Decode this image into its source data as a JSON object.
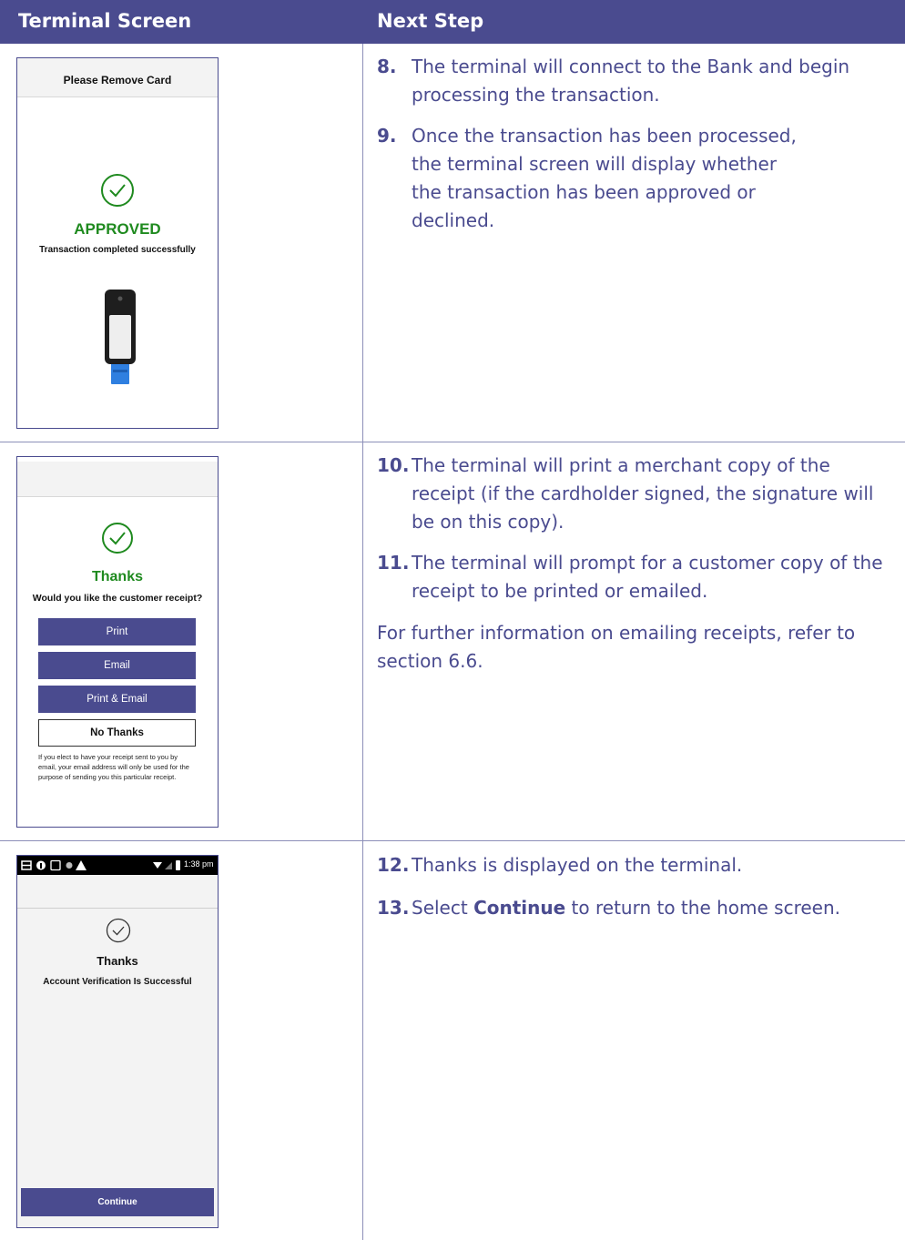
{
  "header": {
    "col1": "Terminal Screen",
    "col2": "Next Step"
  },
  "colors": {
    "brand": "#4a4b8f",
    "approved": "#1f8a1f"
  },
  "rows": [
    {
      "screen": {
        "title": "Please Remove Card",
        "status": "APPROVED",
        "message": "Transaction completed successfully",
        "icon": "check-circle-icon",
        "illustration": "terminal-with-card"
      },
      "steps": [
        {
          "num": "8.",
          "text": "The terminal will connect to the Bank and begin processing the transaction."
        },
        {
          "num": "9.",
          "text": "Once the transaction has been processed, the terminal screen will display whether the transaction has been approved or declined."
        }
      ]
    },
    {
      "screen": {
        "title": "Thanks",
        "question": "Would you like the customer receipt?",
        "icon": "check-circle-icon",
        "buttons": [
          "Print",
          "Email",
          "Print & Email",
          "No Thanks"
        ],
        "disclaimer": "If you elect to have your receipt sent to you by email, your email address will only be used for the purpose of sending you this particular receipt."
      },
      "steps": [
        {
          "num": "10.",
          "text": "The terminal will print a merchant copy of the receipt (if the cardholder signed, the signature will be on this copy)."
        },
        {
          "num": "11.",
          "text": "The terminal will prompt for a customer copy of the receipt to be printed or emailed."
        }
      ],
      "note": "For further information on emailing receipts, refer to section 6.6."
    },
    {
      "screen": {
        "status_time": "1:38 pm",
        "title": "Thanks",
        "message": "Account Verification Is Successful",
        "icon": "check-circle-icon",
        "button": "Continue"
      },
      "steps": [
        {
          "num": "12.",
          "text": "Thanks is displayed on the terminal."
        },
        {
          "num": "13.",
          "pre": "Select ",
          "bold": "Continue",
          "post": " to return to the home screen."
        }
      ]
    }
  ]
}
